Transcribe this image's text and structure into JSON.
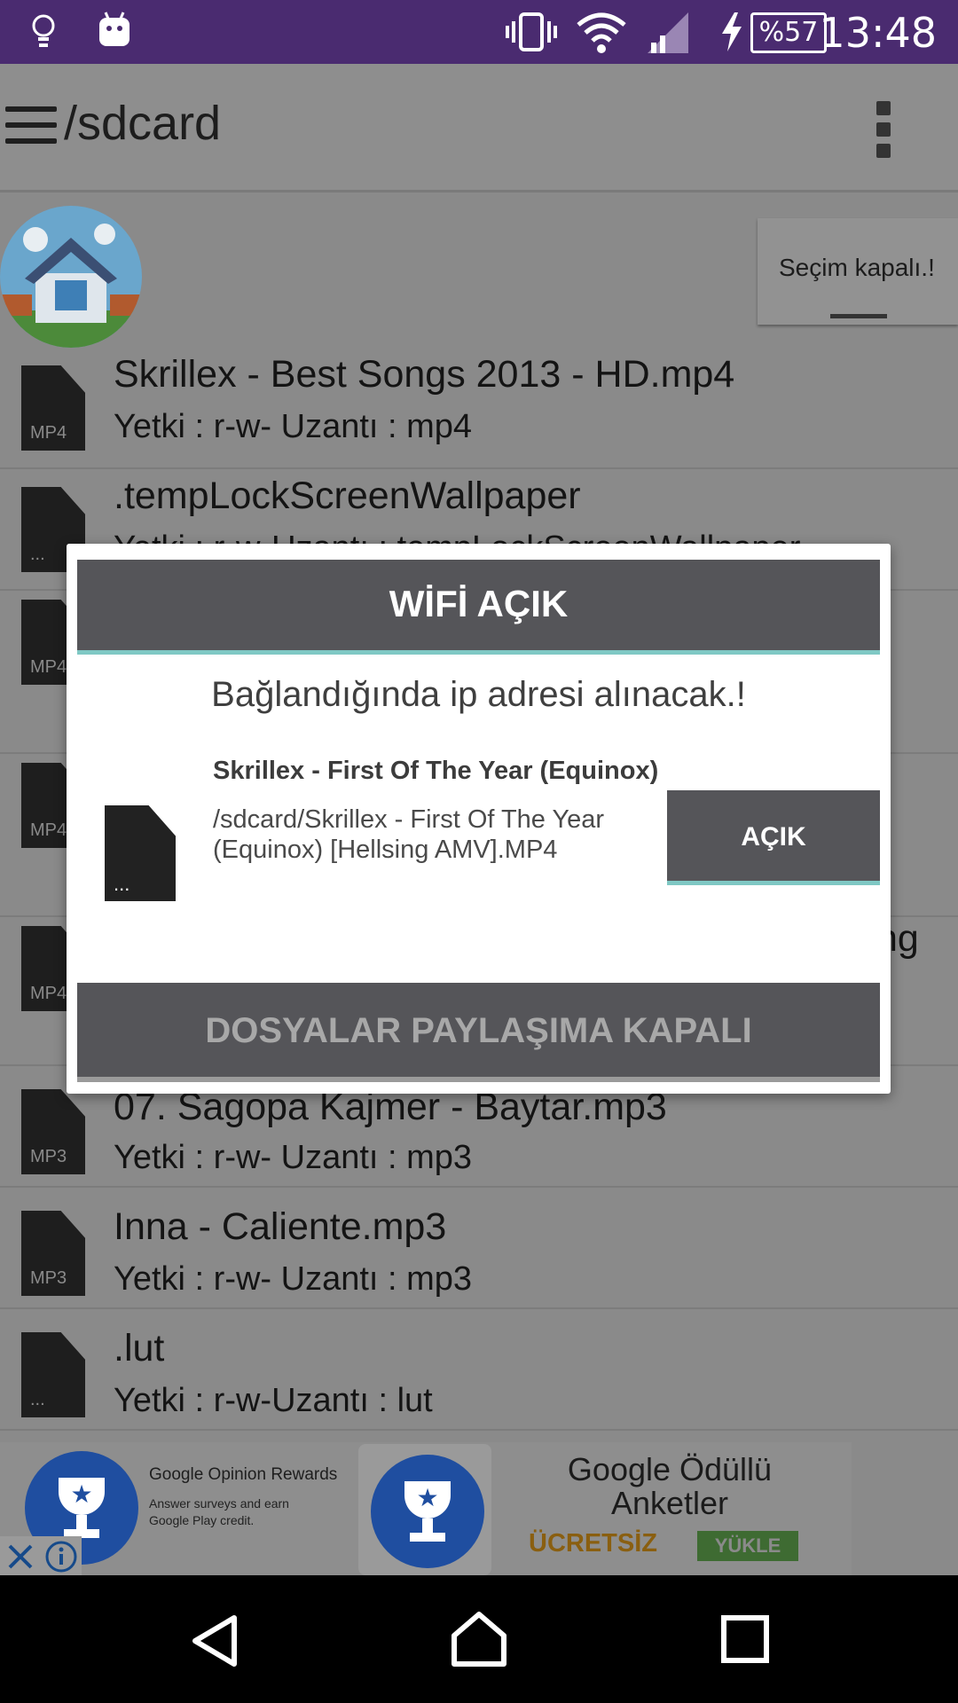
{
  "status_bar": {
    "time": "13:48",
    "battery": "%57"
  },
  "toolbar": {
    "path": "/sdcard"
  },
  "selection_chip": {
    "label": "Seçim kapalı.!"
  },
  "files": [
    {
      "icon_label": "MP4",
      "title": "Skrillex - Best Songs 2013 - HD.mp4",
      "subtitle": "Yetki : r-w-  Uzantı : mp4"
    },
    {
      "icon_label": "...",
      "title": ".tempLockScreenWallpaper",
      "subtitle": "Yetki : r-w-Uzantı : tempLockScreenWallpaper"
    },
    {
      "icon_label": "MP4",
      "title": "",
      "subtitle": ""
    },
    {
      "icon_label": "MP4",
      "title": "",
      "subtitle": ""
    },
    {
      "icon_label": "MP4",
      "title": "ng",
      "subtitle": ""
    },
    {
      "icon_label": "MP3",
      "title": "07. Sagopa Kajmer - Baytar.mp3",
      "subtitle": "Yetki : r-w-  Uzantı : mp3"
    },
    {
      "icon_label": "MP3",
      "title": "Inna - Caliente.mp3",
      "subtitle": "Yetki : r-w-  Uzantı : mp3"
    },
    {
      "icon_label": "...",
      "title": ".lut",
      "subtitle": "Yetki : r-w-Uzantı : lut"
    }
  ],
  "ad": {
    "app_name": "Google Opinion Rewards",
    "tagline": "Answer surveys and earn Google Play credit.",
    "headline": "Google Ödüllü Anketler",
    "price": "ÜCRETSİZ",
    "cta": "YÜKLE"
  },
  "dialog": {
    "title": "WİFİ AÇIK",
    "message": "Bağlandığında ip adresi alınacak.!",
    "file_icon_label": "...",
    "file_name": "Skrillex - First Of The Year (Equinox)",
    "file_path": "/sdcard/Skrillex - First Of The Year (Equinox)  [Hellsing AMV].MP4",
    "toggle_label": "AÇIK",
    "share_label": "DOSYALAR PAYLAŞIMA KAPALI"
  }
}
